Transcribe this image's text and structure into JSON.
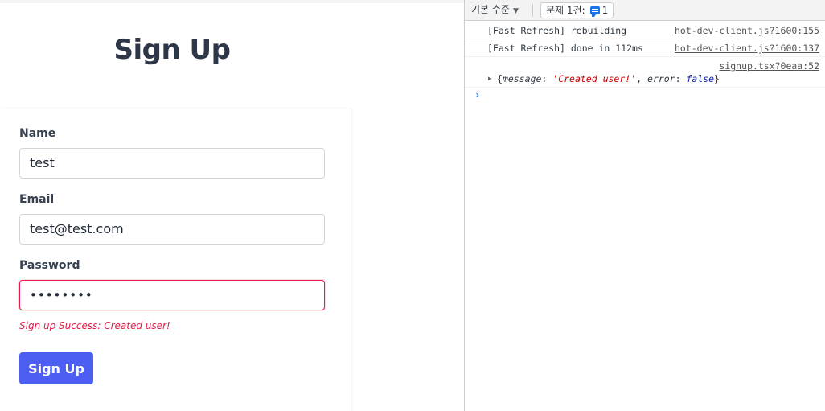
{
  "page": {
    "title": "Sign Up"
  },
  "form": {
    "name_label": "Name",
    "name_value": "test",
    "email_label": "Email",
    "email_value": "test@test.com",
    "password_label": "Password",
    "password_value": "••••••••",
    "status_message": "Sign up Success: Created user!",
    "submit_label": "Sign Up"
  },
  "devtools": {
    "level_selector": "기본 수준",
    "issues_label": "문제 1건:",
    "issues_count": "1",
    "logs": [
      {
        "message": "[Fast Refresh] rebuilding",
        "source": "hot-dev-client.js?1600:155"
      },
      {
        "message": "[Fast Refresh] done in 112ms",
        "source": "hot-dev-client.js?1600:137"
      },
      {
        "source": "signup.tsx?0eaa:52",
        "object": {
          "key1": "message",
          "value1": "'Created user!'",
          "key2": "error",
          "value2": "false"
        }
      }
    ],
    "prompt_symbol": "›"
  },
  "colors": {
    "accent_button": "#4c5ff2",
    "error_red": "#e11d48",
    "title_text": "#2d3748",
    "console_link_blue": "#1a73e8"
  }
}
